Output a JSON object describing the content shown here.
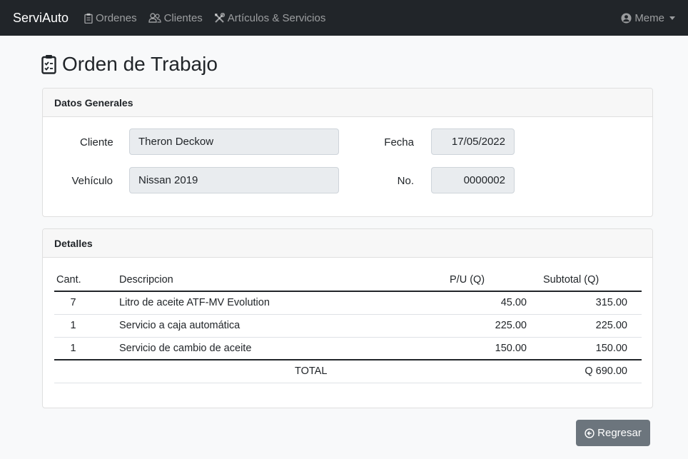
{
  "navbar": {
    "brand": "ServiAuto",
    "items": [
      {
        "label": "Ordenes",
        "icon": "clipboard-icon"
      },
      {
        "label": "Clientes",
        "icon": "people-icon"
      },
      {
        "label": "Artículos & Servicios",
        "icon": "tools-icon"
      }
    ],
    "user": {
      "label": "Meme",
      "icon": "user-circle-icon"
    }
  },
  "page": {
    "title": "Orden de Trabajo",
    "icon": "clipboard-check-icon"
  },
  "general": {
    "header": "Datos Generales",
    "cliente_label": "Cliente",
    "cliente_value": "Theron Deckow",
    "vehiculo_label": "Vehículo",
    "vehiculo_value": "Nissan 2019",
    "fecha_label": "Fecha",
    "fecha_value": "17/05/2022",
    "no_label": "No.",
    "no_value": "0000002"
  },
  "details": {
    "header": "Detalles",
    "columns": [
      "Cant.",
      "Descripcion",
      "P/U (Q)",
      "Subtotal (Q)"
    ],
    "rows": [
      {
        "qty": "7",
        "desc": "Litro de aceite ATF-MV Evolution",
        "pu": "45.00",
        "subtotal": "315.00"
      },
      {
        "qty": "1",
        "desc": "Servicio a caja automática",
        "pu": "225.00",
        "subtotal": "225.00"
      },
      {
        "qty": "1",
        "desc": "Servicio de cambio de aceite",
        "pu": "150.00",
        "subtotal": "150.00"
      }
    ],
    "total_label": "TOTAL",
    "total_value": "Q 690.00"
  },
  "actions": {
    "back_label": "Regresar",
    "back_icon": "arrow-left-circle-icon"
  },
  "colors": {
    "navbar": "#212529",
    "button": "#6c757d",
    "background": "#f8f9fa"
  }
}
